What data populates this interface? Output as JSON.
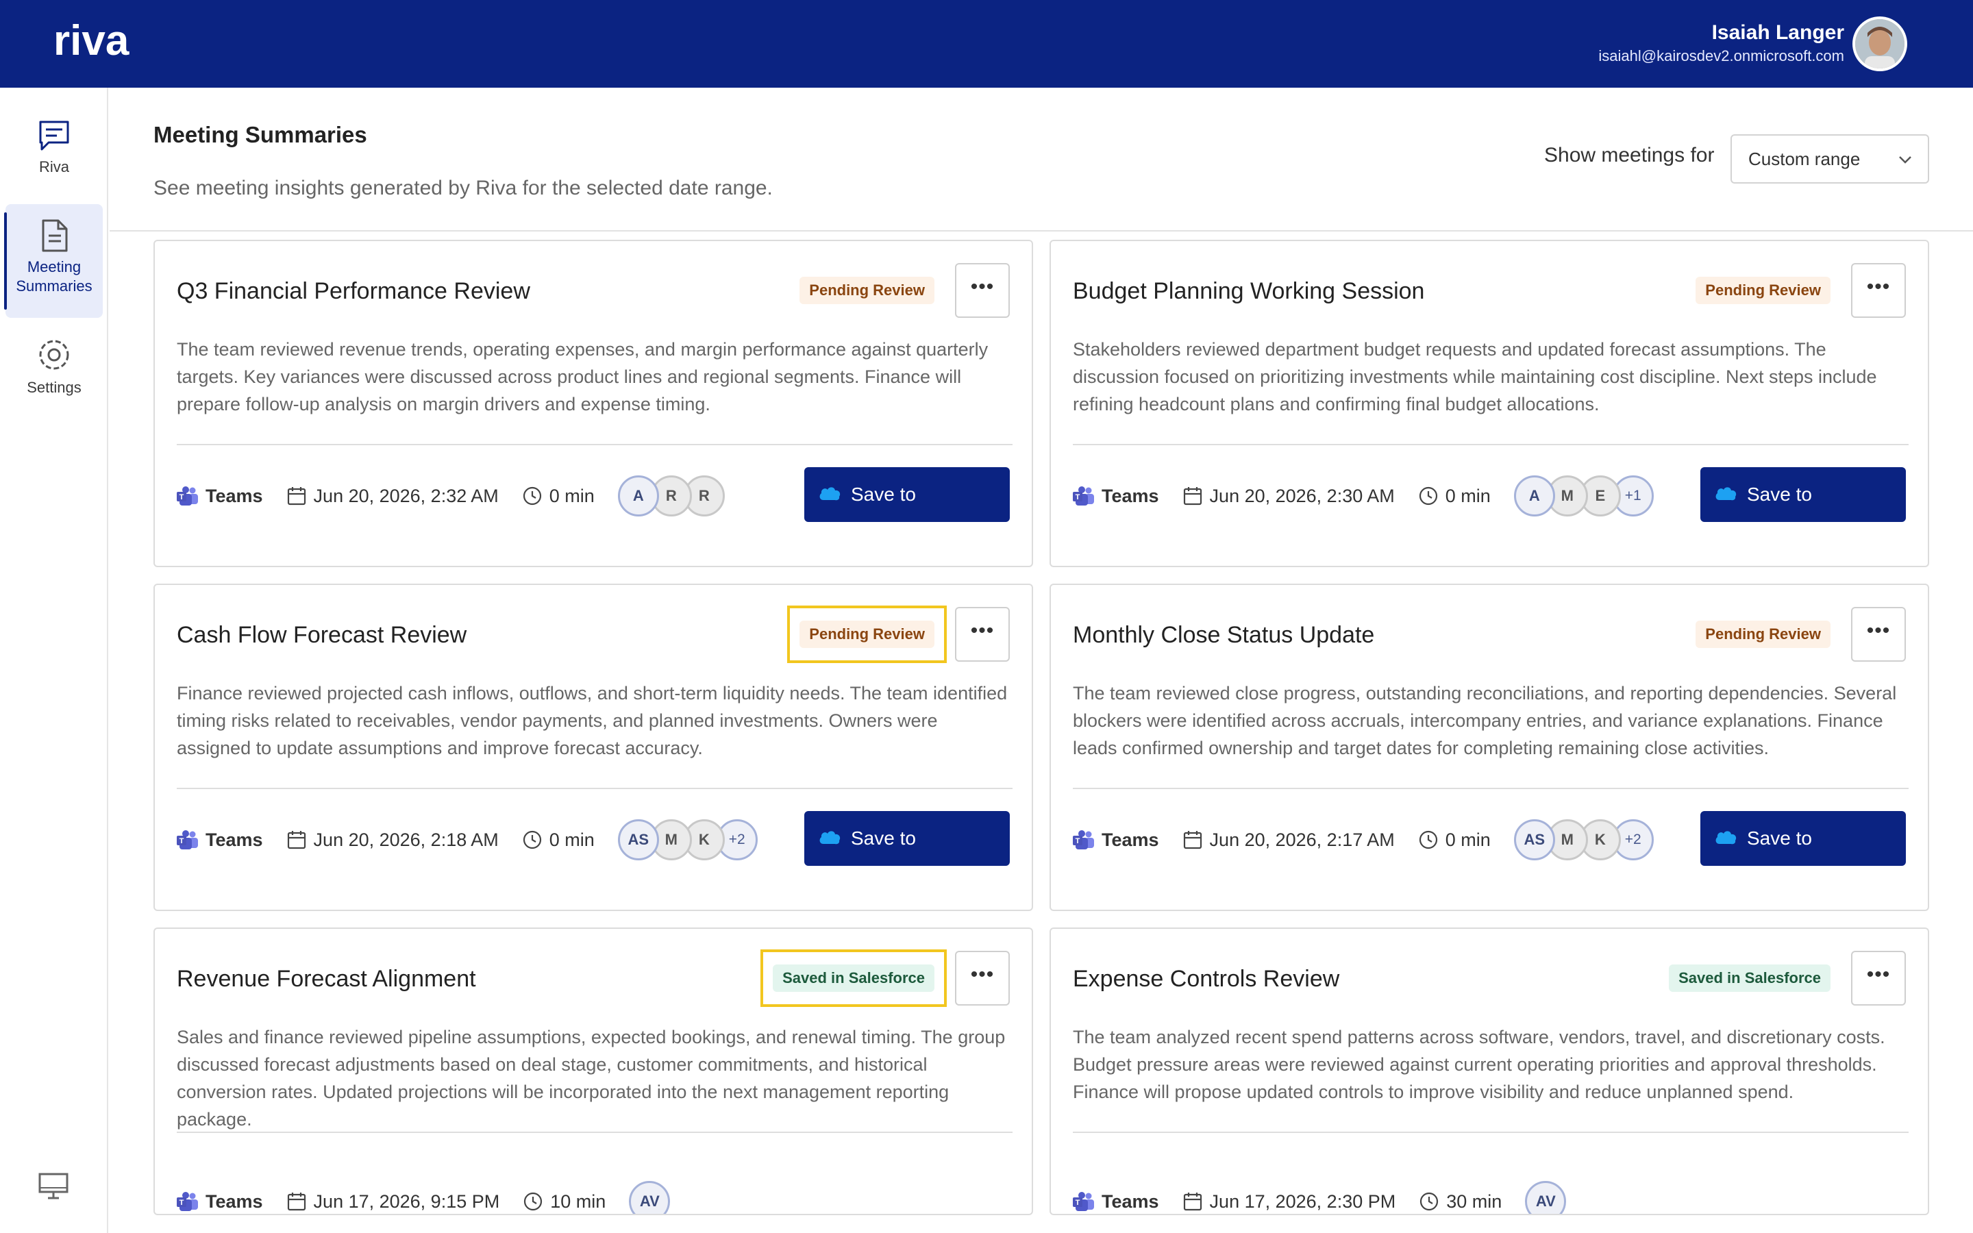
{
  "app": {
    "logo_text": "riva",
    "user_name": "Isaiah Langer",
    "user_email": "isaiahl@kairosdev2.onmicrosoft.com"
  },
  "sidebar": {
    "items": [
      {
        "label": "Riva",
        "icon": "chat-icon"
      },
      {
        "label": "Meeting\nSummaries",
        "icon": "document-icon",
        "active": true
      },
      {
        "label": "Settings",
        "icon": "gear-icon"
      }
    ]
  },
  "header": {
    "title": "Meeting Summaries",
    "subtitle": "See meeting insights generated by Riva for the selected date range.",
    "filter_label": "Show meetings for",
    "filter_value": "Custom range"
  },
  "colors": {
    "brand": "#0b2382",
    "pending_bg": "#fdf1e6",
    "saved_bg": "#e3f5ee",
    "highlight": "#f2c61f"
  },
  "cards": [
    {
      "title": "Q3 Financial Performance Review",
      "status": "Pending Review",
      "description": "The team reviewed revenue trends, operating expenses, and margin performance against quarterly targets. Key variances were discussed across product lines and regional segments. Finance will prepare follow-up analysis on margin drivers and expense timing.",
      "platform": "Teams",
      "date": "Jun 20, 2026, 2:32 AM",
      "duration": "0 min",
      "participants": [
        "A",
        "R",
        "R"
      ],
      "action": "Save to Salesforce"
    },
    {
      "title": "Budget Planning Working Session",
      "status": "Pending Review",
      "description": "Stakeholders reviewed department budget requests and updated forecast assumptions. The discussion focused on prioritizing investments while maintaining cost discipline. Next steps include refining headcount plans and confirming final budget allocations.",
      "platform": "Teams",
      "date": "Jun 20, 2026, 2:30 AM",
      "duration": "0 min",
      "participants": [
        "A",
        "M",
        "E",
        "+1"
      ],
      "action": "Save to Salesforce"
    },
    {
      "title": "Cash Flow Forecast Review",
      "status": "Pending Review",
      "description": "Finance reviewed projected cash inflows, outflows, and short-term liquidity needs. The team identified timing risks related to receivables, vendor payments, and planned investments. Owners were assigned to update assumptions and improve forecast accuracy.",
      "platform": "Teams",
      "date": "Jun 20, 2026, 2:18 AM",
      "duration": "0 min",
      "participants": [
        "AS",
        "M",
        "K",
        "+2"
      ],
      "action": "Save to Salesforce"
    },
    {
      "title": "Monthly Close Status Update",
      "status": "Pending Review",
      "description": "The team reviewed close progress, outstanding reconciliations, and reporting dependencies. Several blockers were identified across accruals, intercompany entries, and variance explanations. Finance leads confirmed ownership and target dates for completing remaining close activities.",
      "platform": "Teams",
      "date": "Jun 20, 2026, 2:17 AM",
      "duration": "0 min",
      "participants": [
        "AS",
        "M",
        "K",
        "+2"
      ],
      "action": "Save to Salesforce"
    },
    {
      "title": "Revenue Forecast Alignment",
      "status": "Saved in Salesforce",
      "description": "Sales and finance reviewed pipeline assumptions, expected bookings, and renewal timing. The group discussed forecast adjustments based on deal stage, customer commitments, and historical conversion rates. Updated projections will be incorporated into the next management reporting package.",
      "platform": "Teams",
      "date": "Jun 17, 2026, 9:15 PM",
      "duration": "10 min",
      "participants": [
        "AV"
      ],
      "action": ""
    },
    {
      "title": "Expense Controls Review",
      "status": "Saved in Salesforce",
      "description": "The team analyzed recent spend patterns across software, vendors, travel, and discretionary costs. Budget pressure areas were reviewed against current operating priorities and approval thresholds. Finance will propose updated controls to improve visibility and reduce unplanned spend.",
      "platform": "Teams",
      "date": "Jun 17, 2026, 2:30 PM",
      "duration": "30 min",
      "participants": [
        "AV"
      ],
      "action": ""
    }
  ]
}
